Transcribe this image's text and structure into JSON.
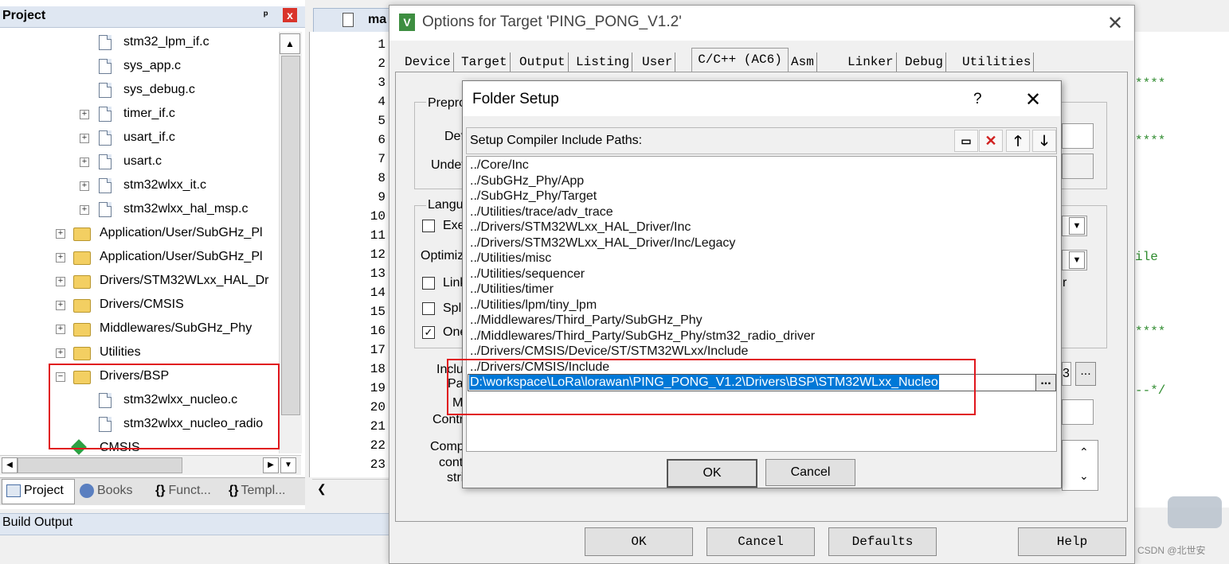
{
  "project": {
    "title": "Project",
    "pin": "ᵖ",
    "close": "x",
    "tree": [
      {
        "label": "stm32_lpm_if.c",
        "type": "file",
        "expand": false
      },
      {
        "label": "sys_app.c",
        "type": "file",
        "expand": false
      },
      {
        "label": "sys_debug.c",
        "type": "file",
        "expand": false
      },
      {
        "label": "timer_if.c",
        "type": "file",
        "expand": true
      },
      {
        "label": "usart_if.c",
        "type": "file",
        "expand": true
      },
      {
        "label": "usart.c",
        "type": "file",
        "expand": true
      },
      {
        "label": "stm32wlxx_it.c",
        "type": "file",
        "expand": true
      },
      {
        "label": "stm32wlxx_hal_msp.c",
        "type": "file",
        "expand": true
      },
      {
        "label": "Application/User/SubGHz_Pl",
        "type": "folder",
        "expand": true
      },
      {
        "label": "Application/User/SubGHz_Pl",
        "type": "folder",
        "expand": true
      },
      {
        "label": "Drivers/STM32WLxx_HAL_Dr",
        "type": "folder",
        "expand": true
      },
      {
        "label": "Drivers/CMSIS",
        "type": "folder",
        "expand": true
      },
      {
        "label": "Middlewares/SubGHz_Phy",
        "type": "folder",
        "expand": true
      },
      {
        "label": "Utilities",
        "type": "folder",
        "expand": true
      },
      {
        "label": "Drivers/BSP",
        "type": "folder-open",
        "expand": true
      },
      {
        "label": "stm32wlxx_nucleo.c",
        "type": "file",
        "expand": false
      },
      {
        "label": "stm32wlxx_nucleo_radio",
        "type": "file",
        "expand": false
      },
      {
        "label": "CMSIS",
        "type": "gem",
        "expand": false
      }
    ],
    "tabs": [
      {
        "label": "Project",
        "icon": "project-icon"
      },
      {
        "label": "Books",
        "icon": "books-icon"
      },
      {
        "label": "Funct...",
        "icon": "braces-icon"
      },
      {
        "label": "Templ...",
        "icon": "template-icon"
      }
    ]
  },
  "build_output": "Build Output",
  "editor": {
    "tab_label": "ma",
    "line_numbers": [
      "1",
      "2",
      "3",
      "4",
      "5",
      "6",
      "7",
      "8",
      "9",
      "10",
      "11",
      "12",
      "13",
      "14",
      "15",
      "16",
      "17",
      "18",
      "19",
      "20",
      "21",
      "22",
      "23"
    ],
    "fragments": {
      "f1": "****",
      "f2": "****",
      "f3": "ile",
      "f4": "****",
      "f5": "--*/"
    }
  },
  "options": {
    "title": "Options for Target 'PING_PONG_V1.2'",
    "tabs": [
      "Device",
      "Target",
      "Output",
      "Listing",
      "User",
      "C/C++ (AC6)",
      "Asm",
      "Linker",
      "Debug",
      "Utilities"
    ],
    "partial_labels": {
      "prepro": "Prepro",
      "def": "Def",
      "undef": "Undef",
      "langu": "Langu",
      "exe": "Exe",
      "optimiz": "Optimiz",
      "link": "Link",
      "spli": "Spli",
      "one": "One",
      "inclu": "Inclu",
      "pat": "Pat",
      "mi": "Mi",
      "contr": "Contr",
      "comp": "Comp",
      "cont": "cont",
      "stri": "stri",
      "r_frag": "r",
      "num3": "3"
    },
    "buttons": {
      "ok": "OK",
      "cancel": "Cancel",
      "defaults": "Defaults",
      "help": "Help",
      "browse": "..."
    }
  },
  "folder_setup": {
    "title": "Folder Setup",
    "help": "?",
    "close": "✕",
    "header": "Setup Compiler Include Paths:",
    "paths": [
      "../Core/Inc",
      "../SubGHz_Phy/App",
      "../SubGHz_Phy/Target",
      "../Utilities/trace/adv_trace",
      "../Drivers/STM32WLxx_HAL_Driver/Inc",
      "../Drivers/STM32WLxx_HAL_Driver/Inc/Legacy",
      "../Utilities/misc",
      "../Utilities/sequencer",
      "../Utilities/timer",
      "../Utilities/lpm/tiny_lpm",
      "../Middlewares/Third_Party/SubGHz_Phy",
      "../Middlewares/Third_Party/SubGHz_Phy/stm32_radio_driver",
      "../Drivers/CMSIS/Device/ST/STM32WLxx/Include",
      "../Drivers/CMSIS/Include"
    ],
    "editing_path": "D:\\workspace\\LoRa\\lorawan\\PING_PONG_V1.2\\Drivers\\BSP\\STM32WLxx_Nucleo",
    "browse": "...",
    "ok": "OK",
    "cancel": "Cancel",
    "toolbar": {
      "new": "new-folder-icon",
      "delete": "delete-icon",
      "up": "move-up-icon",
      "down": "move-down-icon"
    }
  },
  "watermark": "CSDN @北世安"
}
